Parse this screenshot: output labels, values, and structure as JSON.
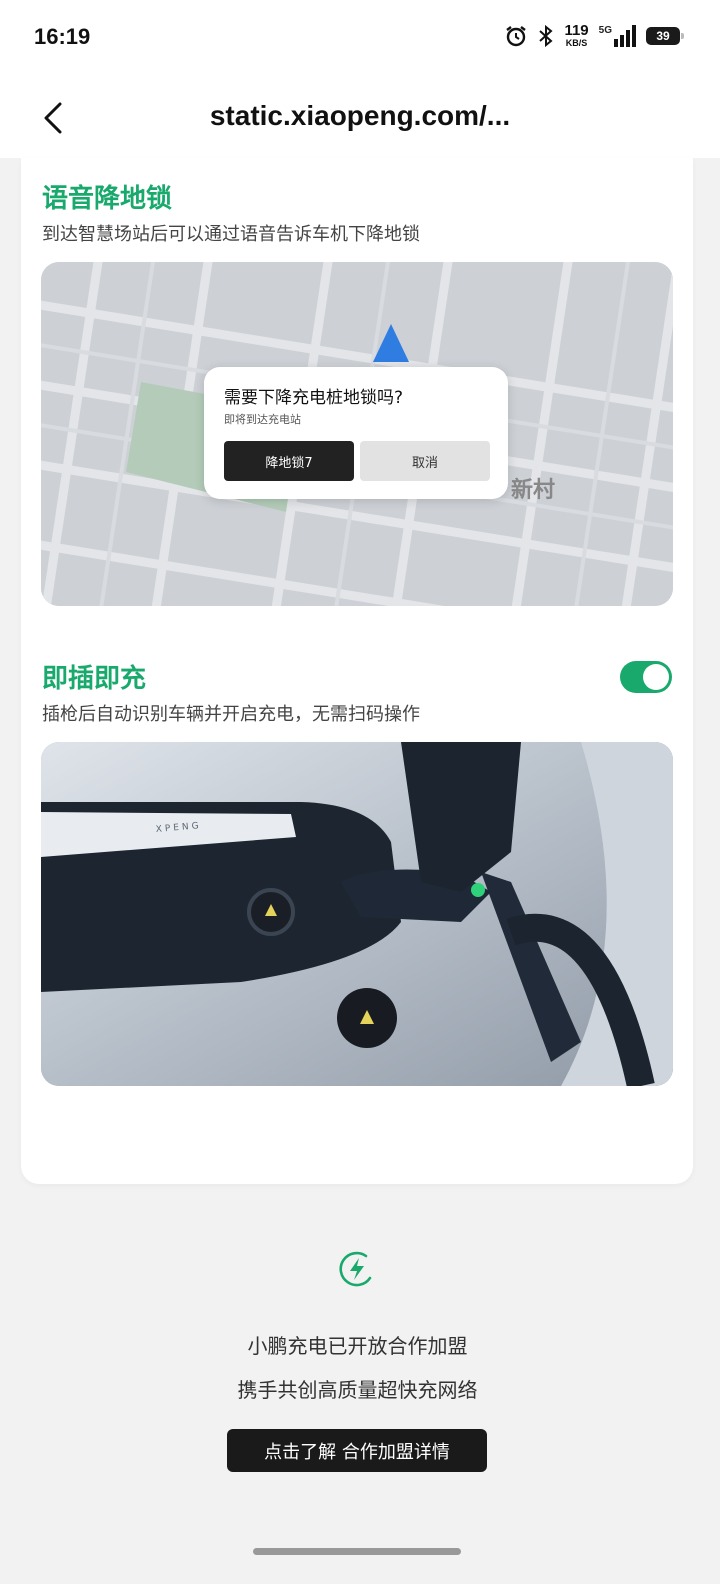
{
  "status_bar": {
    "time": "16:19",
    "speed_value": "119",
    "speed_unit": "KB/S",
    "network": "5G",
    "battery": "39",
    "icons": [
      "alarm-icon",
      "bluetooth-icon",
      "signal-icon",
      "battery-icon"
    ]
  },
  "header": {
    "title": "static.xiaopeng.com/...",
    "back_icon": "chevron-left-icon"
  },
  "section_voice": {
    "title": "语音降地锁",
    "description": "到达智慧场站后可以通过语音告诉车机下降地锁",
    "map_label": "新村",
    "dialog": {
      "title": "需要下降充电桩地锁吗?",
      "subtitle": "即将到达充电站",
      "confirm_label": "降地锁7",
      "cancel_label": "取消"
    }
  },
  "section_plug": {
    "title": "即插即充",
    "description": "插枪后自动识别车辆并开启充电，无需扫码操作",
    "toggle_on": true,
    "car_brand": "XPENG"
  },
  "footer": {
    "line1": "小鹏充电已开放合作加盟",
    "line2": "携手共创高质量超快充网络",
    "cta_label": "点击了解 合作加盟详情",
    "icon": "lightning-charge-icon"
  },
  "colors": {
    "accent": "#1aa96c",
    "background": "#f2f2f2",
    "card": "#ffffff",
    "button_dark": "#1a1a1a"
  }
}
